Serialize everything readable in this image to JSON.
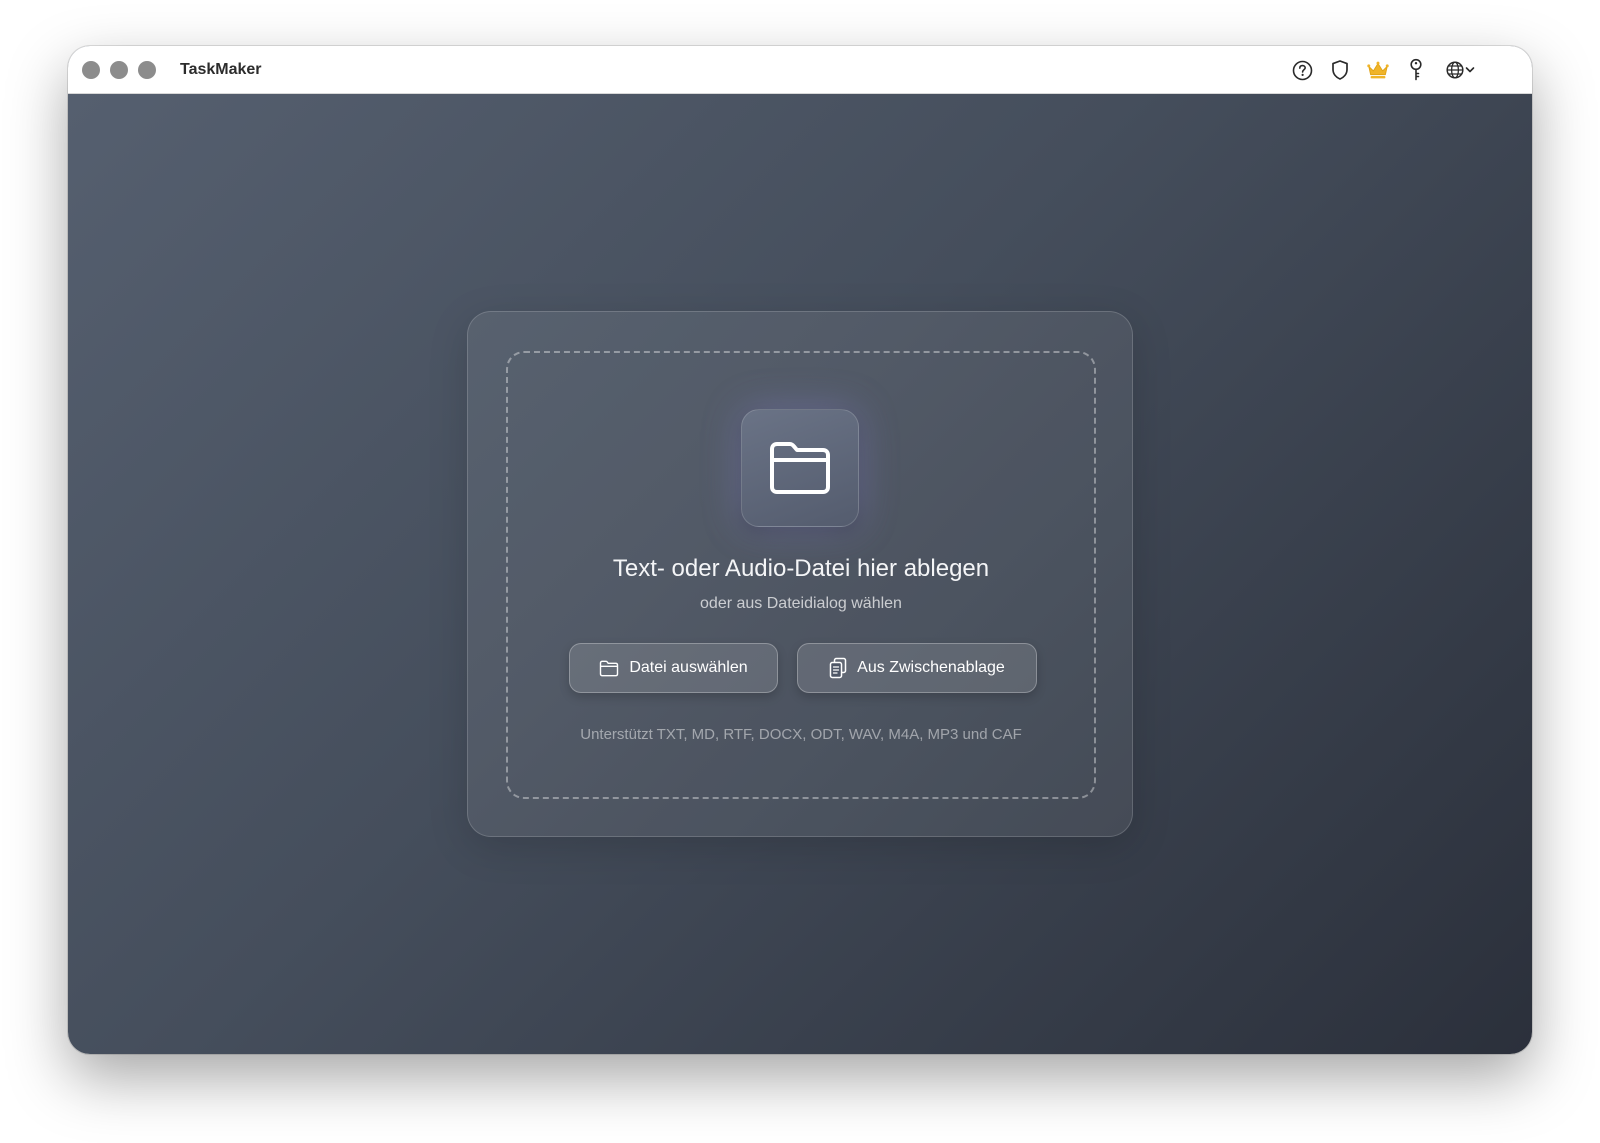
{
  "window": {
    "title": "TaskMaker",
    "traffic_lights": [
      "close",
      "minimize",
      "zoom"
    ]
  },
  "toolbar": {
    "icons": [
      "help-icon",
      "shield-icon",
      "crown-icon",
      "key-icon",
      "globe-icon",
      "chevron-down-icon"
    ],
    "accent_color": "#f0b429"
  },
  "dropzone": {
    "icon": "folder-icon",
    "headline": "Text- oder Audio-Datei hier ablegen",
    "subline": "oder aus Dateidialog wählen",
    "buttons": {
      "choose_file": "Datei auswählen",
      "from_clipboard": "Aus Zwischenablage"
    },
    "supported_formats": "Unterstützt TXT, MD, RTF, DOCX, ODT, WAV, M4A, MP3 und CAF"
  }
}
